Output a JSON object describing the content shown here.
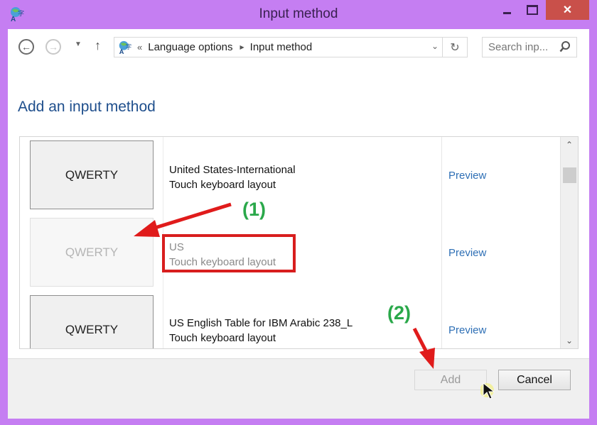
{
  "window": {
    "title": "Input method",
    "minimize_label": "",
    "maximize_label": "",
    "close_label": "✕",
    "frame_color": "#c57ef2",
    "close_color": "#c9504a"
  },
  "navbar": {
    "back_glyph": "←",
    "forward_glyph": "→",
    "recent_glyph": "▼",
    "up_glyph": "↑",
    "breadcrumb_prefix": "«",
    "breadcrumb": [
      {
        "label": "Language options"
      },
      {
        "label": "Input method"
      }
    ],
    "breadcrumb_separator": "▶",
    "dropdown_glyph": "⌄",
    "refresh_glyph": "↻",
    "search_placeholder": "Search inp...",
    "search_value": ""
  },
  "main": {
    "heading": "Add an input method",
    "items": [
      {
        "keyboard": "QWERTY",
        "name": "United States-International",
        "type": "Touch keyboard layout",
        "preview_label": "Preview",
        "disabled": false
      },
      {
        "keyboard": "QWERTY",
        "name": "US",
        "type": "Touch keyboard layout",
        "preview_label": "Preview",
        "disabled": true
      },
      {
        "keyboard": "QWERTY",
        "name": "US English Table for IBM Arabic 238_L",
        "type": "Touch keyboard layout",
        "preview_label": "Preview",
        "disabled": false
      }
    ],
    "scrollbar": {
      "up_glyph": "⌃",
      "down_glyph": "⌄",
      "position_fraction": 0.05
    }
  },
  "footer": {
    "add_label": "Add",
    "add_enabled": false,
    "cancel_label": "Cancel"
  },
  "annotations": {
    "step1": "(1)",
    "step2": "(2)",
    "arrow_color": "#e01b1b",
    "label_color": "#2aa84a"
  }
}
